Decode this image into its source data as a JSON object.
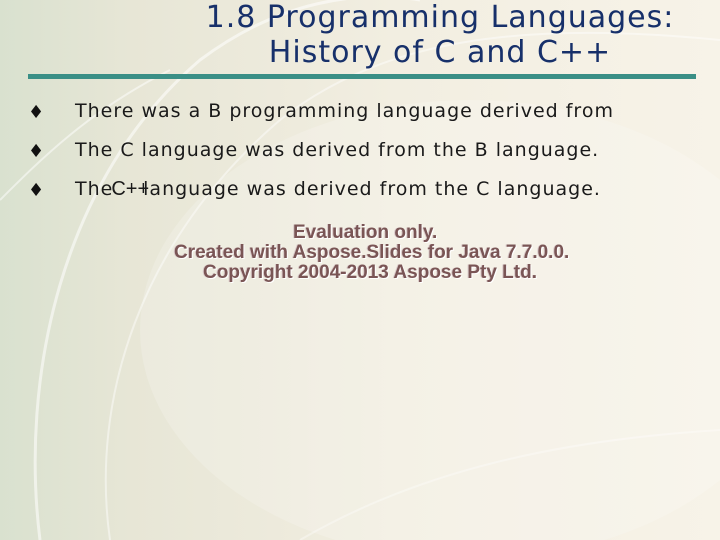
{
  "slide": {
    "title_line1": "1.8 Programming Languages:",
    "title_line2": "History of C and C++",
    "bullets": [
      {
        "text": "There was a B programming language derived from"
      },
      {
        "text": "The C language was derived from the B language."
      },
      {
        "before": "The",
        "emphasis": "C++",
        "after": "language was derived from the C language."
      }
    ],
    "bullet_glyph": "♦"
  },
  "watermark": {
    "line1": "Evaluation only.",
    "line2": "Created with Aspose.Slides for Java 7.7.0.0.",
    "line3": "Copyright 2004-2013 Aspose Pty Ltd."
  },
  "colors": {
    "title": "#17306a",
    "rule": "#3a8f86",
    "watermark": "#7a5555"
  }
}
